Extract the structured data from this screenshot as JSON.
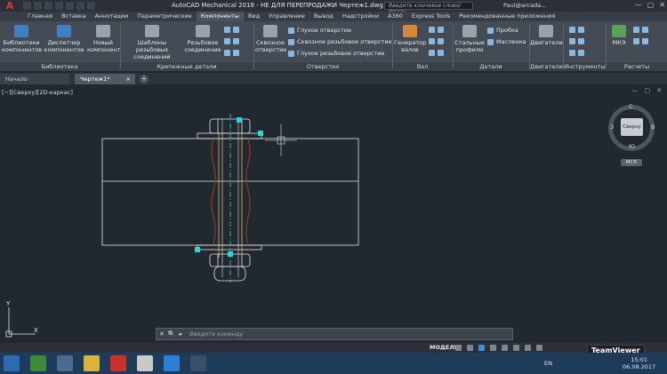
{
  "titlebar": {
    "logo": "A",
    "title": "AutoCAD Mechanical 2018 - НЕ ДЛЯ ПЕРЕПРОДАЖИ   Чертеж1.dwg",
    "search_placeholder": "Введите ключевое слово/фразу",
    "user": "Paul@arcada...",
    "minimize": "—",
    "maximize": "▢",
    "close": "✕"
  },
  "ribbon_tabs": [
    "Главная",
    "Вставка",
    "Аннотации",
    "Параметрические",
    "Компоненты",
    "Вид",
    "Управление",
    "Вывод",
    "Надстройки",
    "A360",
    "Express Tools",
    "Рекомендованные приложения"
  ],
  "active_tab": "Компоненты",
  "ribbon": {
    "library_btn": "Библиотеки компонентов",
    "manager_btn": "Диспетчер компонентов",
    "new_btn": "Новый компонент",
    "library_panel": "Библиотека",
    "thread_templates_btn": "Шаблоны резьбовых соединений",
    "thread_conn_btn": "Резьбовое соединение",
    "fasteners_panel": "Крепежные детали",
    "through_hole_btn": "Сквозное отверстие",
    "blind_hole": "Глухое отверстие",
    "through_thread_hole": "Сквозное резьбовое отверстие",
    "blind_thread_hole": "Глухое резьбовое отверстие",
    "holes_panel": "Отверстия",
    "shaft_gen_btn": "Генератор валов",
    "shaft_panel": "Вал",
    "steel_profiles_btn": "Стальные профили",
    "plug": "Пробка",
    "oiler": "Масленка",
    "details_panel": "Детали",
    "engines_btn": "Двигатели",
    "engines_panel": "Двигатели",
    "tools_panel": "Инструменты",
    "mcalc_btn": "МКЭ",
    "calc_panel": "Расчеты"
  },
  "file_tabs": {
    "start": "Начало",
    "drawing": "Чертеж1*",
    "close": "×",
    "add": "+"
  },
  "viewport": {
    "label": "[−][Сверху][2D-каркас]",
    "controls": [
      "—",
      "▢",
      "✕"
    ]
  },
  "viewcube": {
    "face": "Сверху",
    "north": "С",
    "south": "Ю",
    "west": "З",
    "east": "В",
    "wcs": "МСК"
  },
  "ucs": {
    "x": "X",
    "y": "Y"
  },
  "command": {
    "close": "✕",
    "search": "🔍",
    "prompt_icon": "▸",
    "placeholder": "Введите команду"
  },
  "status": {
    "model": "МОДЕЛЬ"
  },
  "taskbar": {
    "lang": "EN",
    "time": "15:01",
    "date": "06.08.2017",
    "teamviewer": "TeamViewer"
  },
  "colors": {
    "background": "#212830",
    "geometry": "#e8e8e8",
    "bolt_accent": "#e0c15a",
    "grip": "#27d6d6",
    "thread": "#8a3c2a"
  }
}
